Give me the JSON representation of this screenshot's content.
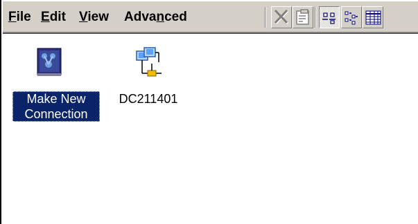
{
  "menu": {
    "file": {
      "pre": "",
      "accel": "F",
      "post": "ile"
    },
    "edit": {
      "pre": "",
      "accel": "E",
      "post": "dit"
    },
    "view": {
      "pre": "",
      "accel": "V",
      "post": "iew"
    },
    "advanced": {
      "pre": "Adva",
      "accel": "n",
      "post": "ced"
    }
  },
  "toolbar": {
    "buttons": [
      {
        "name": "delete",
        "icon": "delete-x-icon",
        "state": "disabled"
      },
      {
        "name": "properties",
        "icon": "properties-icon",
        "state": "disabled"
      },
      {
        "name": "large-icons-view",
        "icon": "large-icons-view-icon",
        "state": "pressed"
      },
      {
        "name": "small-icons-view",
        "icon": "small-icons-view-icon",
        "state": "normal"
      },
      {
        "name": "details-view",
        "icon": "details-view-icon",
        "state": "normal"
      }
    ]
  },
  "items": [
    {
      "line1": "Make New",
      "line2": "Connection",
      "icon": "make-new-connection-icon",
      "selected": true
    },
    {
      "line1": "DC211401",
      "line2": "",
      "icon": "network-connection-icon",
      "selected": false
    }
  ],
  "colors": {
    "chrome": "#d4d0c8",
    "selection": "#0a246a",
    "background": "#ffffff"
  }
}
